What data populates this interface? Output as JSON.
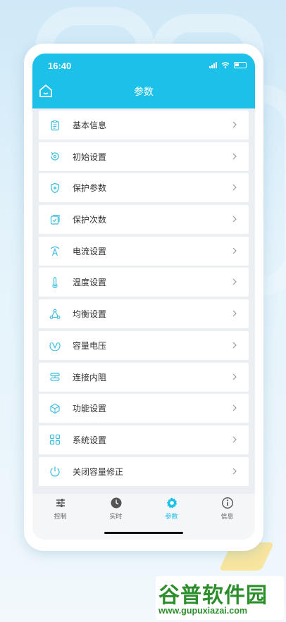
{
  "status_bar": {
    "time": "16:40"
  },
  "header": {
    "title": "参数"
  },
  "menu": {
    "items": [
      {
        "label": "基本信息",
        "icon": "clipboard-icon"
      },
      {
        "label": "初始设置",
        "icon": "reset-icon"
      },
      {
        "label": "保护参数",
        "icon": "shield-plus-icon"
      },
      {
        "label": "保护次数",
        "icon": "shield-check-icon"
      },
      {
        "label": "电流设置",
        "icon": "current-icon"
      },
      {
        "label": "温度设置",
        "icon": "thermometer-icon"
      },
      {
        "label": "均衡设置",
        "icon": "balance-icon"
      },
      {
        "label": "容量电压",
        "icon": "voltage-icon"
      },
      {
        "label": "连接内阻",
        "icon": "resistance-icon"
      },
      {
        "label": "功能设置",
        "icon": "cube-icon"
      },
      {
        "label": "系统设置",
        "icon": "grid-icon"
      },
      {
        "label": "关闭容量修正",
        "icon": "power-icon"
      }
    ]
  },
  "tabbar": {
    "tabs": [
      {
        "label": "控制",
        "icon": "sliders-icon",
        "active": false
      },
      {
        "label": "实时",
        "icon": "clock-icon",
        "active": false
      },
      {
        "label": "参数",
        "icon": "gear-icon",
        "active": true
      },
      {
        "label": "信息",
        "icon": "info-icon",
        "active": false
      }
    ]
  },
  "watermark": {
    "title": "谷普软件园",
    "url": "www.gupuxiazai.com"
  },
  "colors": {
    "accent": "#1cc1ea",
    "icon": "#3fbfe0",
    "text": "#333333",
    "background": "#ebeef3"
  }
}
